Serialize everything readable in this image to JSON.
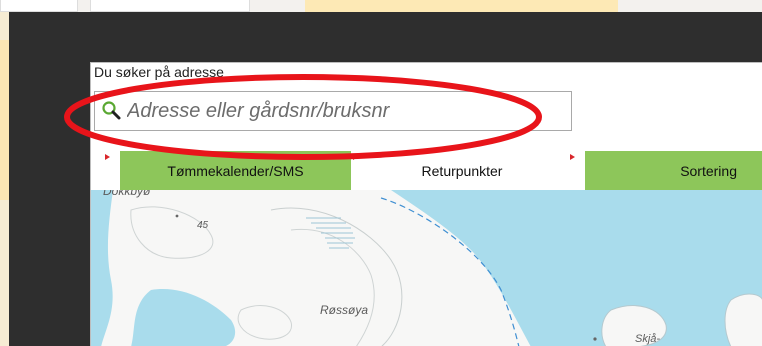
{
  "search": {
    "label": "Du søker på adresse",
    "placeholder": "Adresse eller gårdsnr/bruksnr",
    "value": ""
  },
  "tabs": [
    {
      "label": "Tømmekalender/SMS",
      "active": true
    },
    {
      "label": "Returpunkter",
      "active": false
    },
    {
      "label": "Sortering",
      "active": true
    }
  ],
  "map": {
    "labels": {
      "island_main": "Røssøya",
      "place_right": "Skjå-",
      "height_mark": "45",
      "place_top": "Dokkbyø"
    }
  },
  "colors": {
    "tab_green": "#8dc65a",
    "tab_arrow": "#d9262b",
    "annotation": "#e8141a",
    "water": "#a9dcec",
    "land": "#f7f7f6"
  },
  "icons": {
    "search": "search-icon"
  }
}
